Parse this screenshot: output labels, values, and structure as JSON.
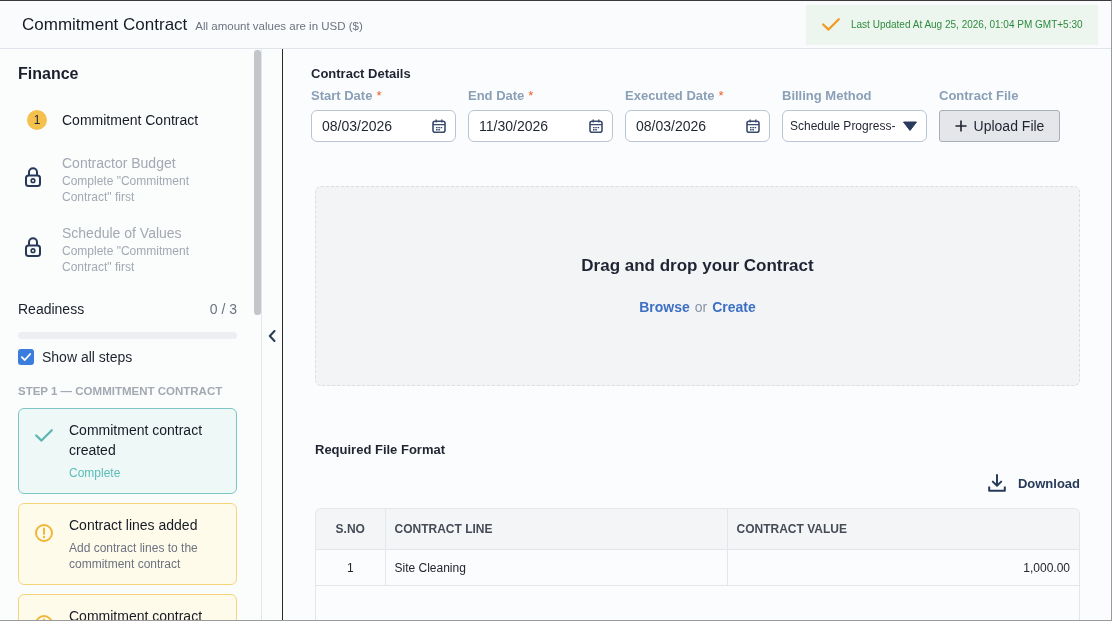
{
  "header": {
    "title": "Commitment Contract",
    "subtitle": "All amount values are in USD ($)",
    "last_updated": "Last Updated At Aug 25, 2026, 01:04 PM GMT+5:30"
  },
  "sidebar": {
    "title": "Finance",
    "steps": [
      {
        "kind": "current",
        "number": "1",
        "label": "Commitment Contract"
      },
      {
        "kind": "locked",
        "label": "Contractor Budget",
        "note": "Complete \"Commitment Contract\" first"
      },
      {
        "kind": "locked",
        "label": "Schedule of Values",
        "note": "Complete \"Commitment Contract\" first"
      }
    ],
    "readiness": {
      "label": "Readiness",
      "count": "0 / 3",
      "level": 0
    },
    "show_all_steps": {
      "label": "Show all steps",
      "checked": true
    },
    "section_heading": "STEP 1 — COMMITMENT CONTRACT",
    "checklist": [
      {
        "complete": true,
        "title": "Commitment contract created",
        "note": "Complete"
      },
      {
        "complete": false,
        "title": "Contract lines added",
        "note": "Add contract lines to the commitment contract"
      },
      {
        "complete": false,
        "title": "Commitment contract"
      }
    ]
  },
  "contract_details": {
    "title": "Contract Details",
    "fields": [
      {
        "kind": "date",
        "label": "Start Date",
        "required_mark": "*",
        "value": "08/03/2026"
      },
      {
        "kind": "date",
        "label": "End Date",
        "required_mark": "*",
        "value": "11/30/2026"
      },
      {
        "kind": "date",
        "label": "Executed Date",
        "required_mark": "*",
        "value": "08/03/2026"
      },
      {
        "kind": "select",
        "label": "Billing Method",
        "value": "Schedule Progress-"
      },
      {
        "kind": "upload",
        "label": "Contract File",
        "button": "Upload File"
      }
    ]
  },
  "dropzone": {
    "title": "Drag and drop your Contract",
    "options": [
      {
        "kind": "link",
        "text": "Browse"
      },
      {
        "kind": "text",
        "text": "or"
      },
      {
        "kind": "link",
        "text": "Create"
      }
    ]
  },
  "file_format": {
    "title": "Required File Format",
    "download": "Download",
    "table": {
      "columns": [
        "S.NO",
        "CONTRACT LINE",
        "CONTRACT VALUE"
      ],
      "rows": [
        [
          "1",
          "Site Cleaning",
          "1,000.00"
        ]
      ]
    }
  }
}
